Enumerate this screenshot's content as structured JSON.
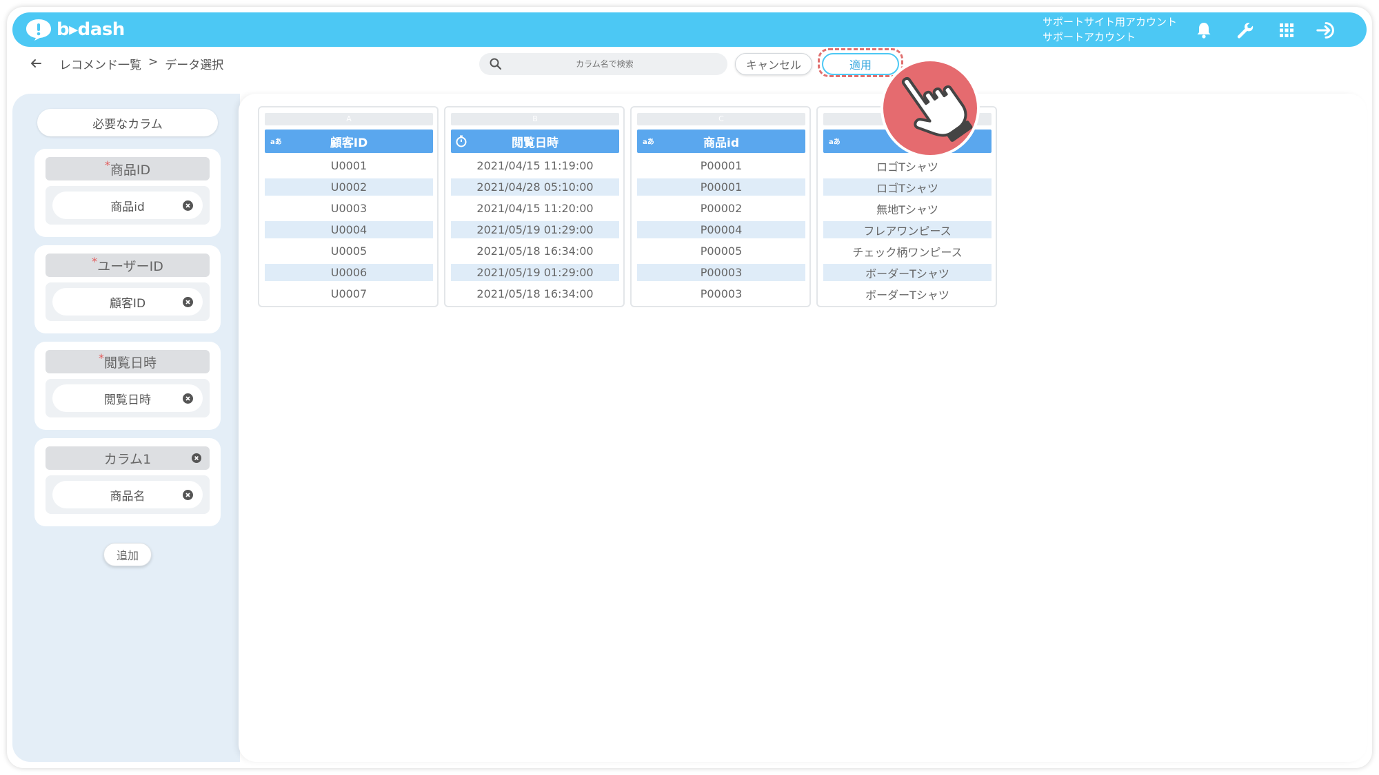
{
  "header": {
    "logo_text": "b▸dash",
    "account_line1": "サポートサイト用アカウント",
    "account_line2": "サポートアカウント",
    "icons": [
      "bell-icon",
      "wrench-icon",
      "grid-icon",
      "logout-icon"
    ],
    "bar_color": "#4cc8f4"
  },
  "subheader": {
    "breadcrumb_parent": "レコメンド一覧",
    "breadcrumb_sep": ">",
    "breadcrumb_current": "データ選択",
    "search_placeholder": "カラム名で検索",
    "cancel_label": "キャンセル",
    "apply_label": "適用"
  },
  "sidebar": {
    "title": "必要なカラム",
    "cards": [
      {
        "required_mark": "*",
        "label": "商品ID",
        "value": "商品id"
      },
      {
        "required_mark": "*",
        "label": "ユーザーID",
        "value": "顧客ID"
      },
      {
        "required_mark": "*",
        "label": "閲覧日時",
        "value": "閲覧日時"
      },
      {
        "required_mark": "",
        "label": "カラム1",
        "value": "商品名"
      }
    ],
    "add_label": "追加"
  },
  "columns": [
    {
      "letter": "A",
      "type_icon": "aあ",
      "name": "顧客ID",
      "rows": [
        "U0001",
        "U0002",
        "U0003",
        "U0004",
        "U0005",
        "U0006",
        "U0007"
      ]
    },
    {
      "letter": "B",
      "type_icon": "timer-icon",
      "name": "閲覧日時",
      "rows": [
        "2021/04/15 11:19:00",
        "2021/04/28 05:10:00",
        "2021/04/15 11:20:00",
        "2021/05/19 01:29:00",
        "2021/05/18 16:34:00",
        "2021/05/19 01:29:00",
        "2021/05/18 16:34:00"
      ]
    },
    {
      "letter": "C",
      "type_icon": "aあ",
      "name": "商品id",
      "rows": [
        "P00001",
        "P00001",
        "P00002",
        "P00004",
        "P00005",
        "P00003",
        "P00003"
      ]
    },
    {
      "letter": "",
      "type_icon": "aあ",
      "name": "",
      "rows": [
        "ロゴTシャツ",
        "ロゴTシャツ",
        "無地Tシャツ",
        "フレアワンピース",
        "チェック柄ワンピース",
        "ボーダーTシャツ",
        "ボーダーTシャツ"
      ]
    }
  ],
  "colors": {
    "accent": "#4cc8f4",
    "column_header": "#5aa7ee",
    "alt_row": "#dfecf8",
    "required": "#e35b5b",
    "highlight": "#e0706f"
  }
}
